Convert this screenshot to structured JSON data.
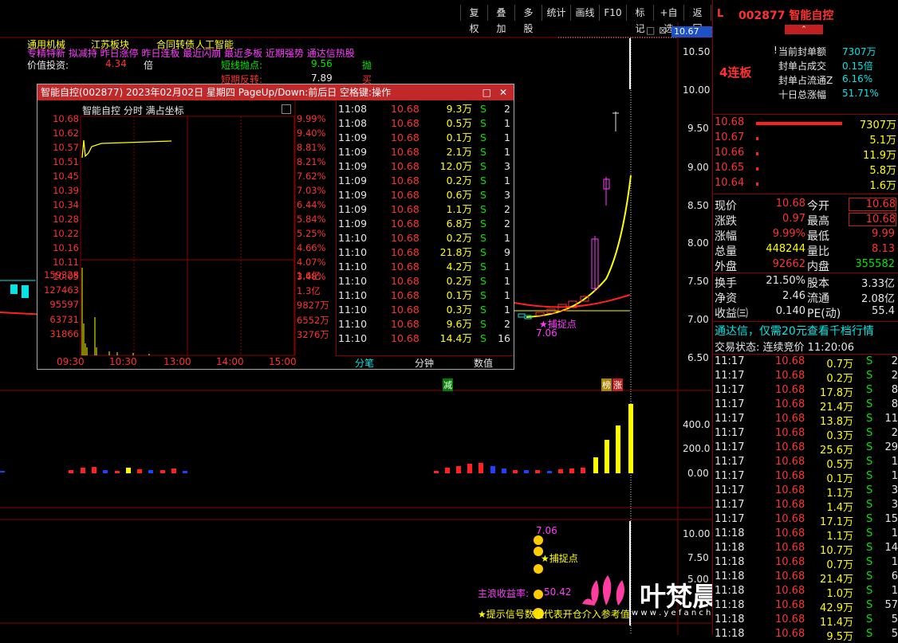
{
  "toolbar": {
    "buttons": [
      "复权",
      "叠加",
      "多股",
      "统计",
      "画线",
      "F10",
      "标记",
      "+自选",
      "返回"
    ]
  },
  "window_controls": [
    "□",
    "⊠"
  ],
  "main_chart": {
    "price_axis": [
      "10.67",
      "10.50",
      "10.00",
      "9.50",
      "9.00",
      "8.50",
      "8.00",
      "7.50",
      "7.00",
      "6.50"
    ],
    "volume_axis": [
      "400.0",
      "200.0",
      "0.00"
    ],
    "lower_axis": [
      "10.00",
      "7.50",
      "5.00"
    ],
    "tags_line1": [
      "通用机械",
      "江苏板块",
      "合同转债",
      "人工智能"
    ],
    "tags_line2": "专精特新 拟减持 昨日涨停 昨日连板 最近闪崩 最近多板 近期强势 通达信热股",
    "value_invest_label": "价值投资:",
    "value_invest_num": "4.34",
    "value_invest_unit": "倍",
    "short_line_label": "短线抛点:",
    "short_line_value": "9.56",
    "short_line_signal": "抛",
    "short_rev_label": "短期反转:",
    "short_rev_value": "7.89",
    "short_rev_signal": "买",
    "catch_label": "★捕捉点",
    "catch_price": "7.06",
    "reduce_tag": "减",
    "limit_tag1": "榜",
    "limit_tag2": "涨",
    "lower_price": "7.06",
    "lower_catch": "★捕捉点",
    "profit_label": "主浪收益率:",
    "profit_value": "50.42",
    "tip_text": "★提示信号数值代表开仓介入参考值",
    "watermark": "叶梵晨指标公式网",
    "watermark_url": "w w w . y e f a n c h e n . c o m"
  },
  "popup": {
    "title": "智能自控(002877) 2023年02月02日 星期四 PageUp/Down:前后日 空格键:操作",
    "subtitle": "智能自控  分时 满占坐标",
    "left_axis": [
      "10.68",
      "10.62",
      "10.57",
      "10.51",
      "10.45",
      "10.39",
      "10.34",
      "10.28",
      "10.22",
      "10.16",
      "10.11",
      "10.05",
      "159328",
      "127463",
      "95597",
      "63731",
      "31866"
    ],
    "right_axis": [
      "9.99%",
      "9.40%",
      "8.81%",
      "8.21%",
      "7.62%",
      "7.03%",
      "6.44%",
      "5.84%",
      "5.25%",
      "4.66%",
      "4.07%",
      "3.48%",
      "1.6亿",
      "1.3亿",
      "9827万",
      "6552万",
      "3276万"
    ],
    "time_axis": [
      "09:30",
      "10:30",
      "13:00",
      "14:00",
      "15:00"
    ],
    "tabs": [
      "分笔",
      "分钟",
      "数值"
    ],
    "ticks": [
      [
        "11:08",
        "10.68",
        "9.3万",
        "S",
        "2"
      ],
      [
        "11:08",
        "10.68",
        "0.5万",
        "S",
        "1"
      ],
      [
        "11:09",
        "10.68",
        "0.1万",
        "S",
        "1"
      ],
      [
        "11:09",
        "10.68",
        "2.1万",
        "S",
        "1"
      ],
      [
        "11:09",
        "10.68",
        "12.0万",
        "S",
        "3"
      ],
      [
        "11:09",
        "10.68",
        "0.2万",
        "S",
        "1"
      ],
      [
        "11:09",
        "10.68",
        "0.6万",
        "S",
        "3"
      ],
      [
        "11:09",
        "10.68",
        "1.1万",
        "S",
        "2"
      ],
      [
        "11:09",
        "10.68",
        "6.8万",
        "S",
        "2"
      ],
      [
        "11:10",
        "10.68",
        "0.2万",
        "S",
        "1"
      ],
      [
        "11:10",
        "10.68",
        "21.8万",
        "S",
        "9"
      ],
      [
        "11:10",
        "10.68",
        "4.2万",
        "S",
        "1"
      ],
      [
        "11:10",
        "10.68",
        "0.2万",
        "S",
        "1"
      ],
      [
        "11:10",
        "10.68",
        "0.1万",
        "S",
        "1"
      ],
      [
        "11:10",
        "10.68",
        "0.3万",
        "S",
        "1"
      ],
      [
        "11:10",
        "10.68",
        "9.6万",
        "S",
        "2"
      ],
      [
        "11:10",
        "10.68",
        "14.4万",
        "S",
        "16"
      ]
    ],
    "chart_line_value": 10.57
  },
  "right": {
    "code_prefix": "L",
    "stock": "002877 智能自控",
    "streak": "4连板",
    "seal_lines": [
      [
        "当前封单额",
        "7307万"
      ],
      [
        "封单占成交",
        "0.15倍"
      ],
      [
        "封单占流通Z",
        "6.16%"
      ],
      [
        "十日总涨幅",
        "51.71%"
      ]
    ],
    "orderbook": [
      [
        "10.68",
        "7307万",
        1.0
      ],
      [
        "10.67",
        "5.1万",
        0.02
      ],
      [
        "10.66",
        "11.9万",
        0.02
      ],
      [
        "10.65",
        "5.8万",
        0.02
      ],
      [
        "10.64",
        "1.6万",
        0.02
      ]
    ],
    "quote": [
      [
        "现价",
        "10.68",
        "今开",
        "10.68"
      ],
      [
        "涨跌",
        "0.97",
        "最高",
        "10.68"
      ],
      [
        "涨幅",
        "9.99%",
        "最低",
        "9.99"
      ],
      [
        "总量",
        "448244",
        "量比",
        "8.13"
      ],
      [
        "外盘",
        "92662",
        "内盘",
        "355582"
      ]
    ],
    "quote2": [
      [
        "换手",
        "21.50%",
        "股本",
        "3.33亿"
      ],
      [
        "净资",
        "2.46",
        "流通",
        "2.08亿"
      ],
      [
        "收益㈢",
        "0.140",
        "PE(动)",
        "55.4"
      ]
    ],
    "promo": "通达信，仅需20元查看千档行情",
    "trade_status": "交易状态: 连续竞价 11:20:06",
    "ticks": [
      [
        "11:17",
        "10.68",
        "0.7万",
        "S",
        "2"
      ],
      [
        "11:17",
        "10.68",
        "0.2万",
        "S",
        "2"
      ],
      [
        "11:17",
        "10.68",
        "17.8万",
        "S",
        "8"
      ],
      [
        "11:17",
        "10.68",
        "21.4万",
        "S",
        "8"
      ],
      [
        "11:17",
        "10.68",
        "13.8万",
        "S",
        "11"
      ],
      [
        "11:17",
        "10.68",
        "0.3万",
        "S",
        "2"
      ],
      [
        "11:17",
        "10.68",
        "25.6万",
        "S",
        "29"
      ],
      [
        "11:17",
        "10.68",
        "0.5万",
        "S",
        "1"
      ],
      [
        "11:17",
        "10.68",
        "0.1万",
        "S",
        "1"
      ],
      [
        "11:17",
        "10.68",
        "1.1万",
        "S",
        "3"
      ],
      [
        "11:17",
        "10.68",
        "1.4万",
        "S",
        "3"
      ],
      [
        "11:17",
        "10.68",
        "17.1万",
        "S",
        "15"
      ],
      [
        "11:18",
        "10.68",
        "1.1万",
        "S",
        "1"
      ],
      [
        "11:18",
        "10.68",
        "10.7万",
        "S",
        "14"
      ],
      [
        "11:18",
        "10.68",
        "0.7万",
        "S",
        "1"
      ],
      [
        "11:18",
        "10.68",
        "21.4万",
        "S",
        "6"
      ],
      [
        "11:18",
        "10.68",
        "1.0万",
        "S",
        "1"
      ],
      [
        "11:18",
        "10.68",
        "42.9万",
        "S",
        "57"
      ],
      [
        "11:18",
        "10.68",
        "11.4万",
        "S",
        "5"
      ],
      [
        "11:18",
        "10.68",
        "9.5万",
        "S",
        "5"
      ]
    ]
  },
  "colors": {
    "red": "#ff3232",
    "green": "#00e600",
    "yellow": "#ffff00",
    "magenta": "#ff3cff",
    "border": "#8a0000"
  }
}
